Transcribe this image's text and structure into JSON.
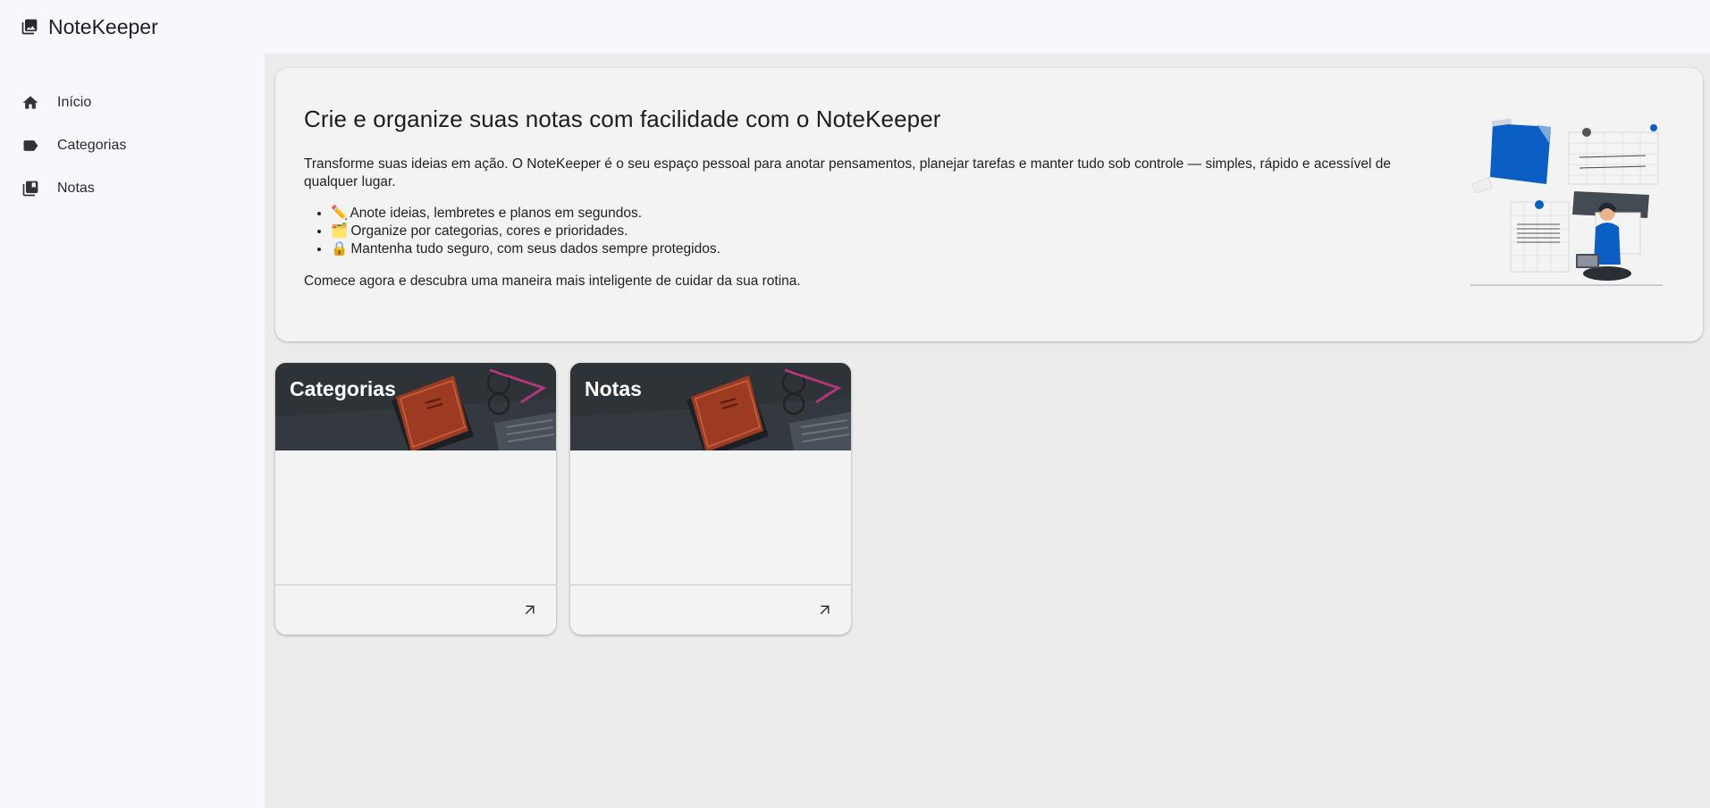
{
  "app": {
    "title": "NoteKeeper",
    "logo_icon": "photo-library-icon"
  },
  "sidebar": {
    "items": [
      {
        "label": "Início",
        "icon": "home-icon"
      },
      {
        "label": "Categorias",
        "icon": "label-icon"
      },
      {
        "label": "Notas",
        "icon": "library-books-icon"
      }
    ]
  },
  "hero": {
    "heading": "Crie e organize suas notas com facilidade com o NoteKeeper",
    "intro": "Transforme suas ideias em ação. O NoteKeeper é o seu espaço pessoal para anotar pensamentos, planejar tarefas e manter tudo sob controle — simples, rápido e acessível de qualquer lugar.",
    "bullets": [
      {
        "emoji": "✏️",
        "text": "Anote ideias, lembretes e planos em segundos."
      },
      {
        "emoji": "🗂️",
        "text": "Organize por categorias, cores e prioridades."
      },
      {
        "emoji": "🔒",
        "text": "Mantenha tudo seguro, com seus dados sempre protegidos."
      }
    ],
    "outro": "Comece agora e descubra uma maneira mais inteligente de cuidar da sua rotina.",
    "illustration": "notes-board-illustration"
  },
  "cards": [
    {
      "title": "Categorias",
      "action_icon": "arrow-outward-icon"
    },
    {
      "title": "Notas",
      "action_icon": "arrow-outward-icon"
    }
  ],
  "colors": {
    "accent": "#0b5fc4",
    "banner": "#2e3338",
    "book": "#9c3a22"
  }
}
